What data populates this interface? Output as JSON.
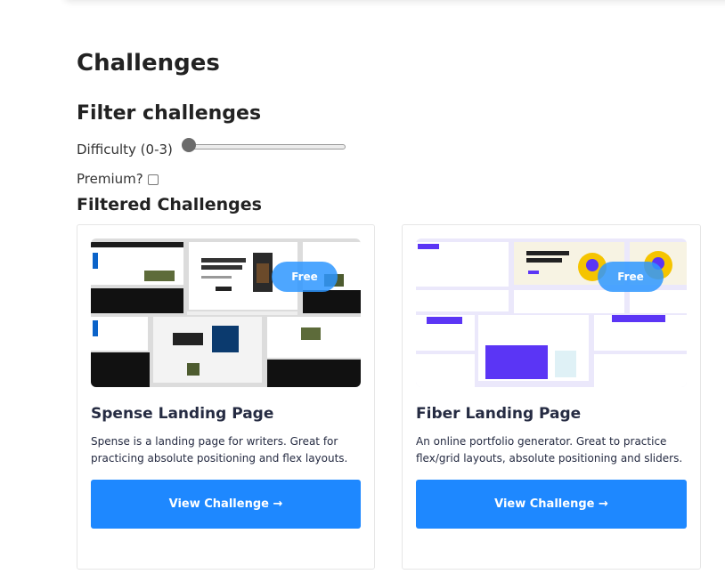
{
  "page": {
    "title": "Challenges"
  },
  "filters": {
    "title": "Filter challenges",
    "difficulty_label": "Difficulty (0-3)",
    "difficulty_value": 0,
    "difficulty_range": [
      0,
      3
    ],
    "premium_label": "Premium?",
    "premium_checked": false
  },
  "results": {
    "title": "Filtered Challenges",
    "cards": [
      {
        "badge": "Free",
        "title": "Spense Landing Page",
        "description": "Spense is a landing page for writers. Great for practicing absolute positioning and flex layouts.",
        "button": "View Challenge →"
      },
      {
        "badge": "Free",
        "title": "Fiber Landing Page",
        "description": "An online portfolio generator. Great to practice flex/grid layouts, absolute positioning and sliders.",
        "button": "View Challenge →"
      }
    ]
  },
  "colors": {
    "accent": "#1e88ff",
    "badge": "#2e96ff",
    "heading": "#252b42",
    "fiber_brand": "#5b35f5"
  }
}
